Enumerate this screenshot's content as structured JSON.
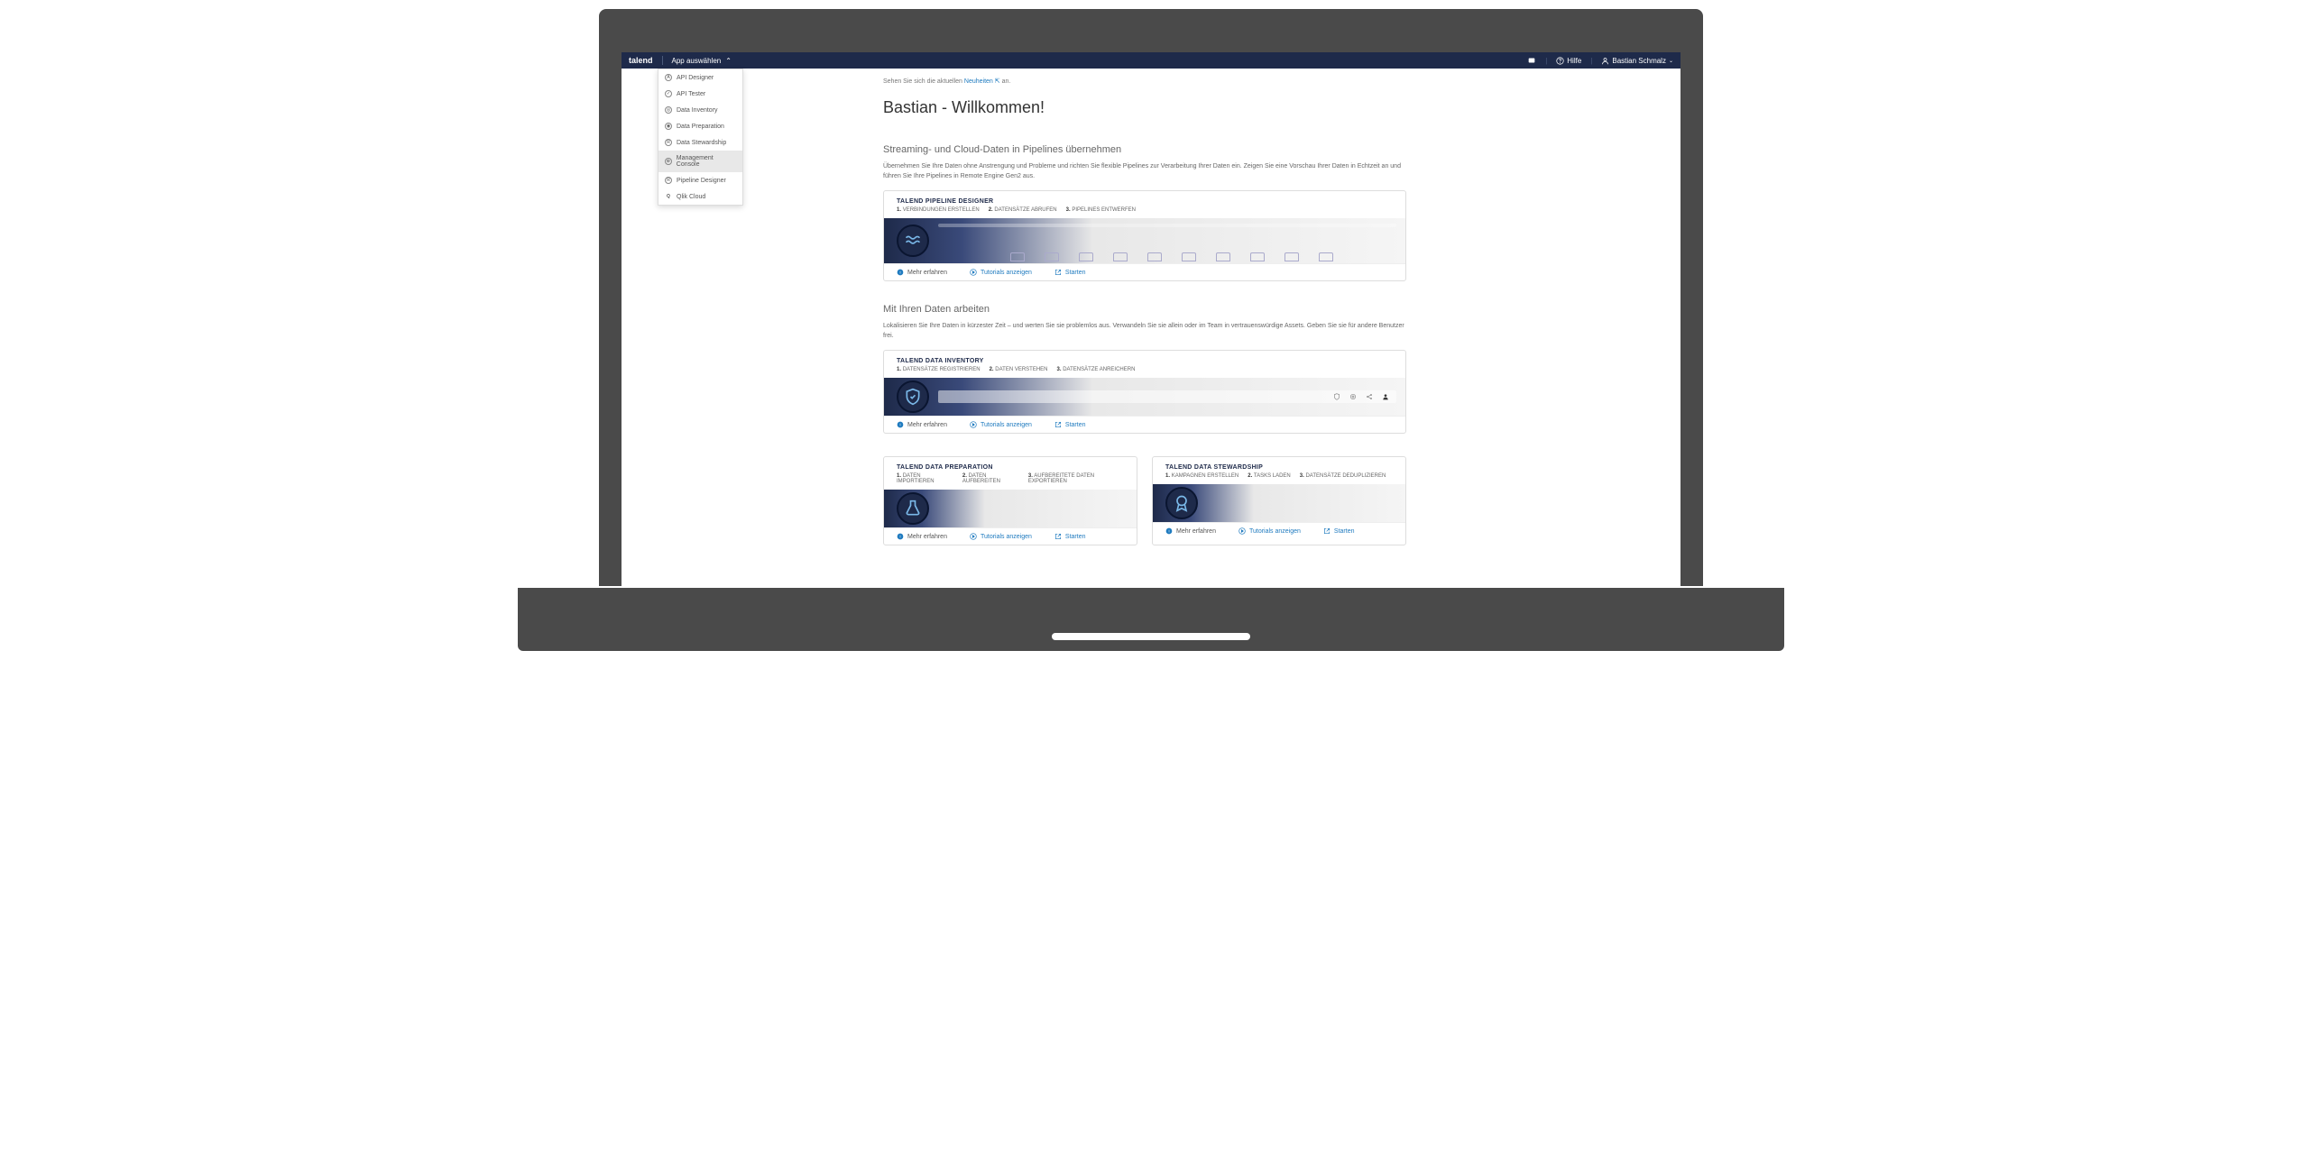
{
  "header": {
    "brand": "talend",
    "app_select_label": "App auswählen",
    "help_label": "Hilfe",
    "user_name": "Bastian Schmalz"
  },
  "app_menu": {
    "items": [
      {
        "label": "API Designer",
        "icon": "A"
      },
      {
        "label": "API Tester",
        "icon": "✓"
      },
      {
        "label": "Data Inventory",
        "icon": "◎"
      },
      {
        "label": "Data Preparation",
        "icon": "◉"
      },
      {
        "label": "Data Stewardship",
        "icon": "R"
      },
      {
        "label": "Management Console",
        "icon": "⊕",
        "active": true
      },
      {
        "label": "Pipeline Designer",
        "icon": "R"
      },
      {
        "label": "Qlik Cloud",
        "icon": "Q"
      }
    ]
  },
  "news": {
    "prefix": "Sehen Sie sich die aktuellen ",
    "link_text": "Neuheiten",
    "suffix": " an."
  },
  "welcome_title": "Bastian - Willkommen!",
  "sections": [
    {
      "title": "Streaming- und Cloud-Daten in Pipelines übernehmen",
      "desc": "Übernehmen Sie Ihre Daten ohne Anstrengung und Probleme und richten Sie flexible Pipelines zur Verarbeitung Ihrer Daten ein. Zeigen Sie eine Vorschau Ihrer Daten in Echtzeit an und führen Sie Ihre Pipelines in Remote Engine Gen2 aus.",
      "cards": [
        {
          "title": "TALEND PIPELINE DESIGNER",
          "steps": [
            "VERBINDUNGEN ERSTELLEN",
            "DATENSÄTZE ABRUFEN",
            "PIPELINES ENTWERFEN"
          ],
          "icon": "waves",
          "actions": {
            "learn": "Mehr erfahren",
            "tutorials": "Tutorials anzeigen",
            "start": "Starten"
          }
        }
      ]
    },
    {
      "title": "Mit Ihren Daten arbeiten",
      "desc": "Lokalisieren Sie Ihre Daten in kürzester Zeit – und werten Sie sie problemlos aus. Verwandeln Sie sie allein oder im Team in vertrauenswürdige Assets. Geben Sie sie für andere Benutzer frei.",
      "cards": [
        {
          "title": "TALEND DATA INVENTORY",
          "steps": [
            "DATENSÄTZE REGISTRIEREN",
            "DATEN VERSTEHEN",
            "DATENSÄTZE ANREICHERN"
          ],
          "icon": "shield",
          "actions": {
            "learn": "Mehr erfahren",
            "tutorials": "Tutorials anzeigen",
            "start": "Starten"
          }
        }
      ],
      "row_cards": [
        {
          "title": "TALEND DATA PREPARATION",
          "steps": [
            "DATEN IMPORTIEREN",
            "DATEN AUFBEREITEN",
            "AUFBEREITETE DATEN EXPORTIEREN"
          ],
          "icon": "flask",
          "actions": {
            "learn": "Mehr erfahren",
            "tutorials": "Tutorials anzeigen",
            "start": "Starten"
          }
        },
        {
          "title": "TALEND DATA STEWARDSHIP",
          "steps": [
            "KAMPAGNEN ERSTELLEN",
            "TASKS LADEN",
            "DATENSÄTZE DEDUPLIZIEREN"
          ],
          "icon": "badge",
          "actions": {
            "learn": "Mehr erfahren",
            "tutorials": "Tutorials anzeigen",
            "start": "Starten"
          }
        }
      ]
    }
  ]
}
